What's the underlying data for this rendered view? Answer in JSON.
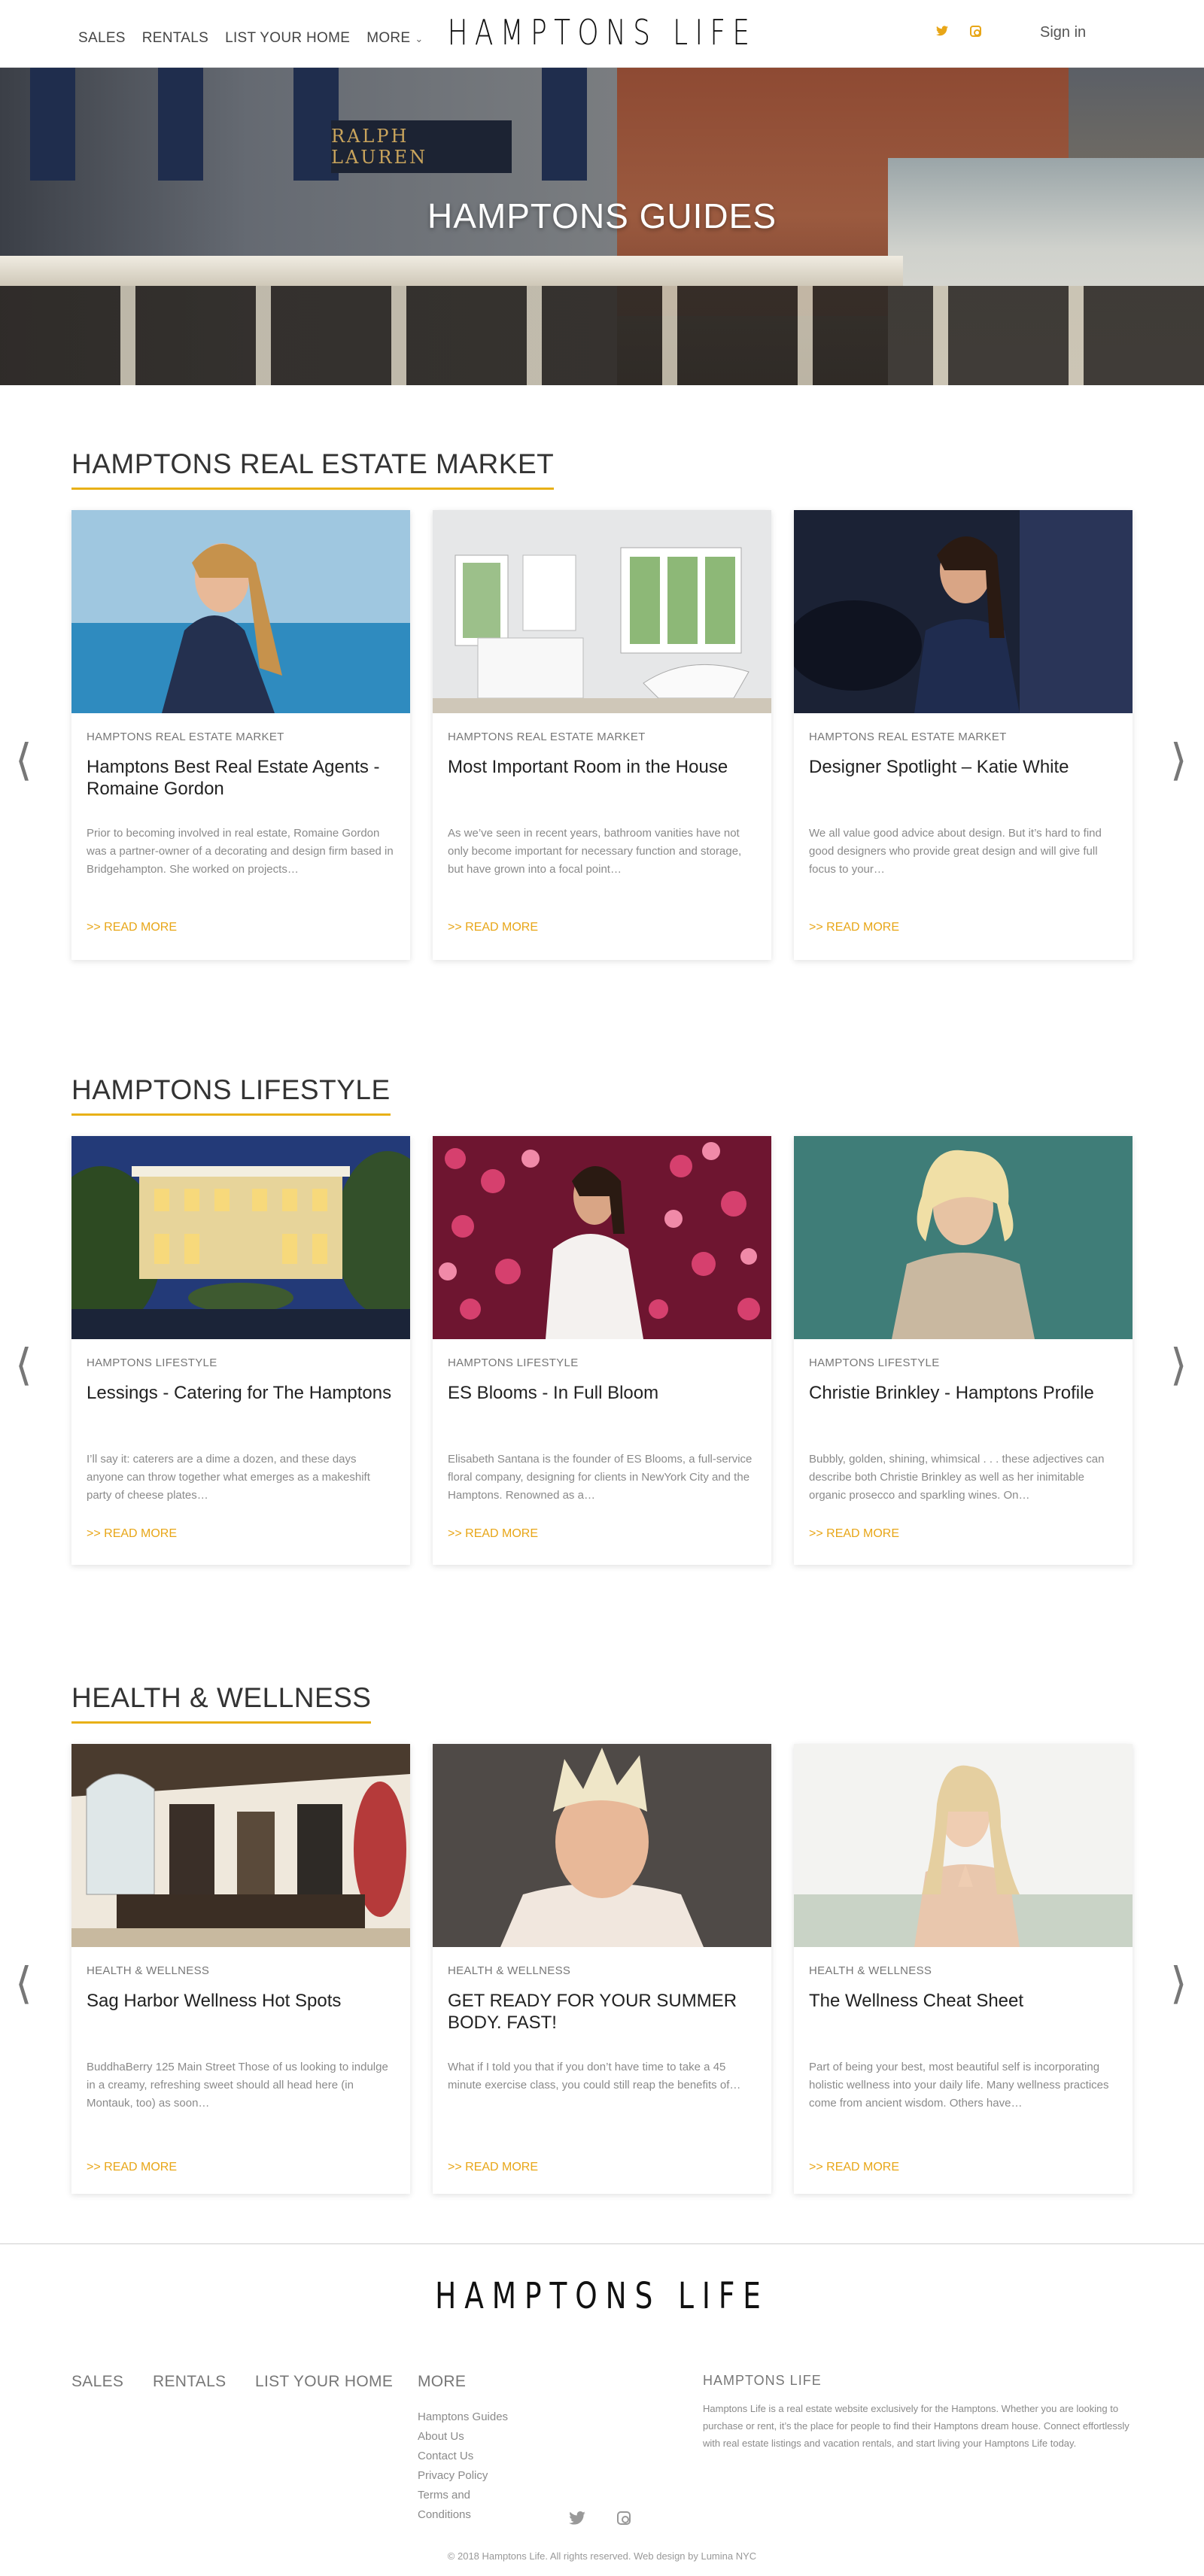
{
  "header": {
    "nav": [
      "SALES",
      "RENTALS",
      "LIST YOUR HOME",
      "MORE"
    ],
    "more_caret": "⌄",
    "logo": "HAMPTONS LIFE",
    "signin": "Sign in",
    "twitter_icon": "twitter-icon",
    "instagram_icon": "instagram-icon"
  },
  "hero": {
    "title": "HAMPTONS GUIDES",
    "sign_text": "RALPH LAUREN"
  },
  "sections": [
    {
      "title": "HAMPTONS REAL ESTATE MARKET",
      "cards": [
        {
          "category": "HAMPTONS REAL ESTATE MARKET",
          "title": "Hamptons Best Real Estate Agents - Romaine Gordon",
          "excerpt": "Prior to becoming involved in real estate, Romaine Gordon was a partner-owner of a decorating and design firm based in Bridgehampton. She worked on projects…",
          "more": ">> READ MORE"
        },
        {
          "category": "HAMPTONS REAL ESTATE MARKET",
          "title": "Most Important Room in the House",
          "excerpt": "As we’ve seen in recent years, bathroom vanities have not only become important for necessary function and storage, but have grown into a focal point…",
          "more": ">> READ MORE"
        },
        {
          "category": "HAMPTONS REAL ESTATE MARKET",
          "title": "Designer Spotlight – Katie White",
          "excerpt": "We all value good advice about design. But it’s hard to find good designers who provide great design and will give full focus to your…",
          "more": ">> READ MORE"
        }
      ]
    },
    {
      "title": "HAMPTONS LIFESTYLE",
      "cards": [
        {
          "category": "HAMPTONS LIFESTYLE",
          "title": "Lessings - Catering for The Hamptons",
          "excerpt": "I’ll say it: caterers are a dime a dozen, and these days anyone can throw together what emerges as a makeshift party of cheese plates…",
          "more": ">> READ MORE"
        },
        {
          "category": "HAMPTONS LIFESTYLE",
          "title": "ES Blooms - In Full Bloom",
          "excerpt": "Elisabeth Santana is the founder of ES Blooms, a full-service floral company, designing for clients in NewYork City and the Hamptons. Renowned as a…",
          "more": ">> READ MORE"
        },
        {
          "category": "HAMPTONS LIFESTYLE",
          "title": "Christie Brinkley - Hamptons Profile",
          "excerpt": "Bubbly, golden, shining, whimsical . . . these adjectives can describe both Christie Brinkley as well as her inimitable organic prosecco and sparkling wines. On…",
          "more": ">> READ MORE"
        }
      ]
    },
    {
      "title": "HEALTH & WELLNESS",
      "cards": [
        {
          "category": "HEALTH & WELLNESS",
          "title": "Sag Harbor Wellness Hot Spots",
          "excerpt": "BuddhaBerry   125 Main Street Those of us looking to indulge in a creamy, refreshing sweet should all head here (in Montauk, too) as soon…",
          "more": ">> READ MORE"
        },
        {
          "category": "HEALTH & WELLNESS",
          "title": "GET READY FOR YOUR SUMMER BODY. FAST!",
          "excerpt": "What if I told you that if you don’t have time to take a 45 minute exercise class, you could still reap the benefits of…",
          "more": ">> READ MORE"
        },
        {
          "category": "HEALTH & WELLNESS",
          "title": "The Wellness Cheat Sheet",
          "excerpt": "Part of being your best, most beautiful self is incorporating holistic wellness into your daily life. Many wellness practices come from ancient wisdom. Others have…",
          "more": ">> READ MORE"
        }
      ]
    }
  ],
  "arrows": {
    "left": "⟨",
    "right": "⟩"
  },
  "footer": {
    "logo": "HAMPTONS LIFE",
    "nav": [
      "SALES",
      "RENTALS",
      "LIST YOUR HOME",
      "MORE"
    ],
    "more_links": [
      "Hamptons Guides",
      "About Us",
      "Contact Us",
      "Privacy Policy",
      "Terms and",
      "Conditions"
    ],
    "about_title": "HAMPTONS LIFE",
    "about_text": "Hamptons Life is a real estate website exclusively for the Hamptons. Whether you are looking to purchase or rent, it’s the place for people to find their Hamptons dream house. Connect effortlessly with real estate listings and vacation rentals, and start living your Hamptons Life today.",
    "copyright": "© 2018 Hamptons Life. All rights reserved. Web design by Lumina NYC"
  },
  "colors": {
    "accent": "#e8a617",
    "underline": "#e8b017",
    "text": "#333333"
  }
}
